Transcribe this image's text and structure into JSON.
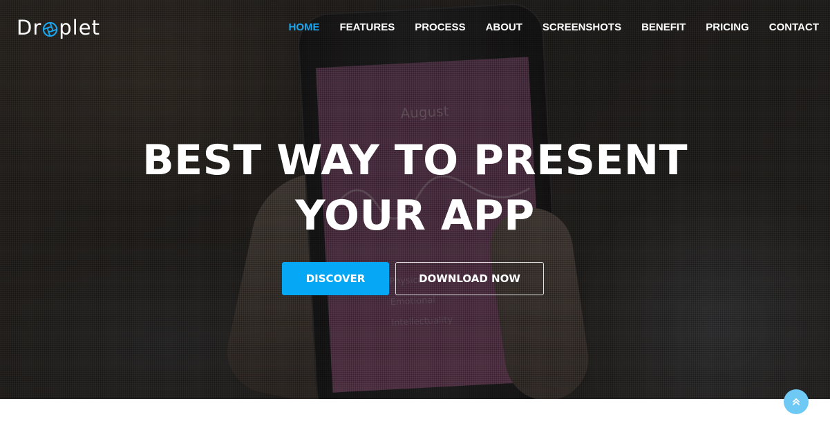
{
  "logo": {
    "prefix": "Dr",
    "suffix": "plet",
    "icon": "aperture-icon",
    "icon_color": "#1aa7f0"
  },
  "nav": {
    "items": [
      {
        "label": "HOME",
        "active": true
      },
      {
        "label": "FEATURES",
        "active": false
      },
      {
        "label": "PROCESS",
        "active": false
      },
      {
        "label": "ABOUT",
        "active": false
      },
      {
        "label": "SCREENSHOTS",
        "active": false
      },
      {
        "label": "BENEFIT",
        "active": false
      },
      {
        "label": "PRICING",
        "active": false
      },
      {
        "label": "CONTACT",
        "active": false
      }
    ],
    "active_color": "#1aa7f0"
  },
  "hero": {
    "headline_line1": "BEST WAY TO PRESENT",
    "headline_line2": "YOUR APP",
    "discover_label": "DISCOVER",
    "download_label": "DOWNLOAD NOW",
    "discover_color": "#06a7f5"
  },
  "scroll_top": {
    "icon": "double-chevron-up-icon",
    "color": "#6fc9f5"
  }
}
